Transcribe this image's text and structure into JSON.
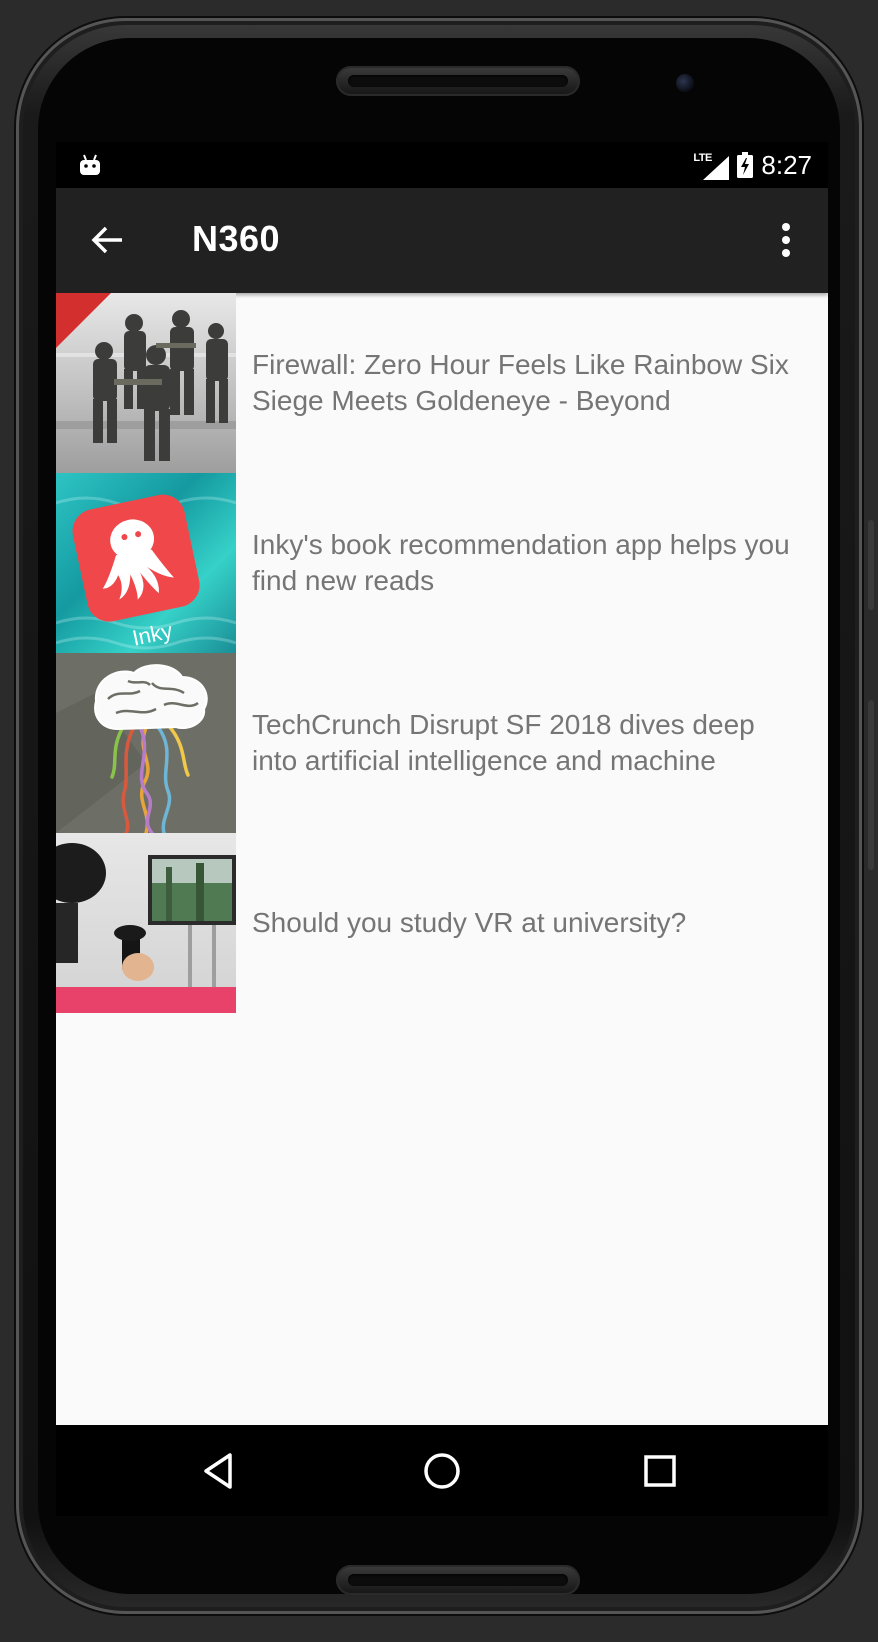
{
  "status_bar": {
    "network_label": "LTE",
    "time": "8:27"
  },
  "app_bar": {
    "title": "N360",
    "back_icon": "arrow-back-icon",
    "menu_icon": "more-vert-icon"
  },
  "articles": [
    {
      "title": "Firewall: Zero Hour Feels Like Rainbow Six Siege Meets Goldeneye - Beyond",
      "thumbnail": "soldiers-squad-image"
    },
    {
      "title": "Inky's book recommendation app helps you find new reads",
      "thumbnail": "inky-app-logo-image",
      "thumbnail_text": "Inky"
    },
    {
      "title": "TechCrunch Disrupt SF 2018 dives deep into artificial intelligence and machine",
      "thumbnail": "brain-wires-illustration"
    },
    {
      "title": "Should you study VR at university?",
      "thumbnail": "vr-headset-photo"
    }
  ],
  "nav_bar": {
    "back": "nav-back-icon",
    "home": "nav-home-icon",
    "recents": "nav-recents-icon"
  },
  "colors": {
    "app_bar": "#212121",
    "status_bar": "#000000",
    "list_background": "#fafafa",
    "item_text": "#757575"
  }
}
